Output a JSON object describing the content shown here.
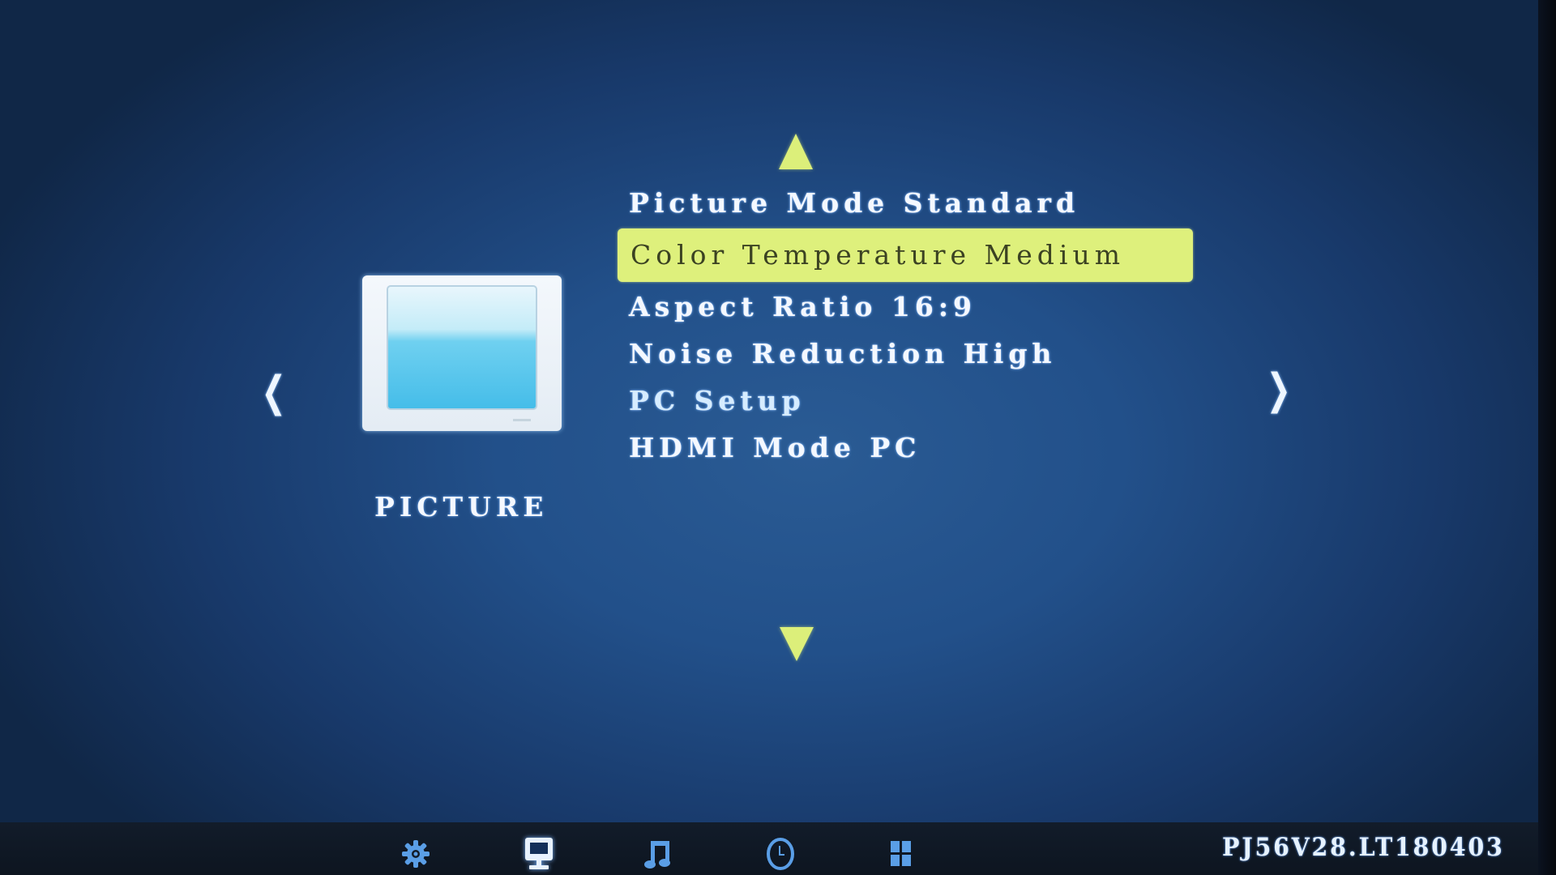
{
  "osd": {
    "category": "PICTURE",
    "menu_items": [
      {
        "label": "Picture Mode Standard",
        "state": "normal"
      },
      {
        "label": "Color Temperature Medium",
        "state": "selected"
      },
      {
        "label": "Aspect Ratio 16:9",
        "state": "normal"
      },
      {
        "label": "Noise Reduction High",
        "state": "normal"
      },
      {
        "label": "PC Setup",
        "state": "submenu"
      },
      {
        "label": "HDMI Mode PC",
        "state": "normal"
      }
    ],
    "nav": {
      "up_icon": "triangle-up-icon",
      "down_icon": "triangle-down-icon",
      "left_icon": "chevron-left-icon",
      "right_icon": "chevron-right-icon"
    }
  },
  "bottom_bar": {
    "tabs": [
      {
        "icon": "gear-icon",
        "name": "settings",
        "active": false
      },
      {
        "icon": "monitor-icon",
        "name": "picture",
        "active": true
      },
      {
        "icon": "music-note-icon",
        "name": "sound",
        "active": false
      },
      {
        "icon": "clock-icon",
        "name": "time",
        "active": false
      },
      {
        "icon": "grid-icon",
        "name": "option",
        "active": false
      }
    ],
    "version": "PJ56V28.LT180403"
  },
  "colors": {
    "highlight": "#def07c",
    "highlight_text": "#3b4222",
    "arrow": "#dcef7a",
    "text": "#f4f8ff",
    "icon_inactive": "#5a9ee6",
    "icon_active": "#e8f2ff",
    "background_center": "#2a5b94",
    "background_edge": "#102747"
  }
}
